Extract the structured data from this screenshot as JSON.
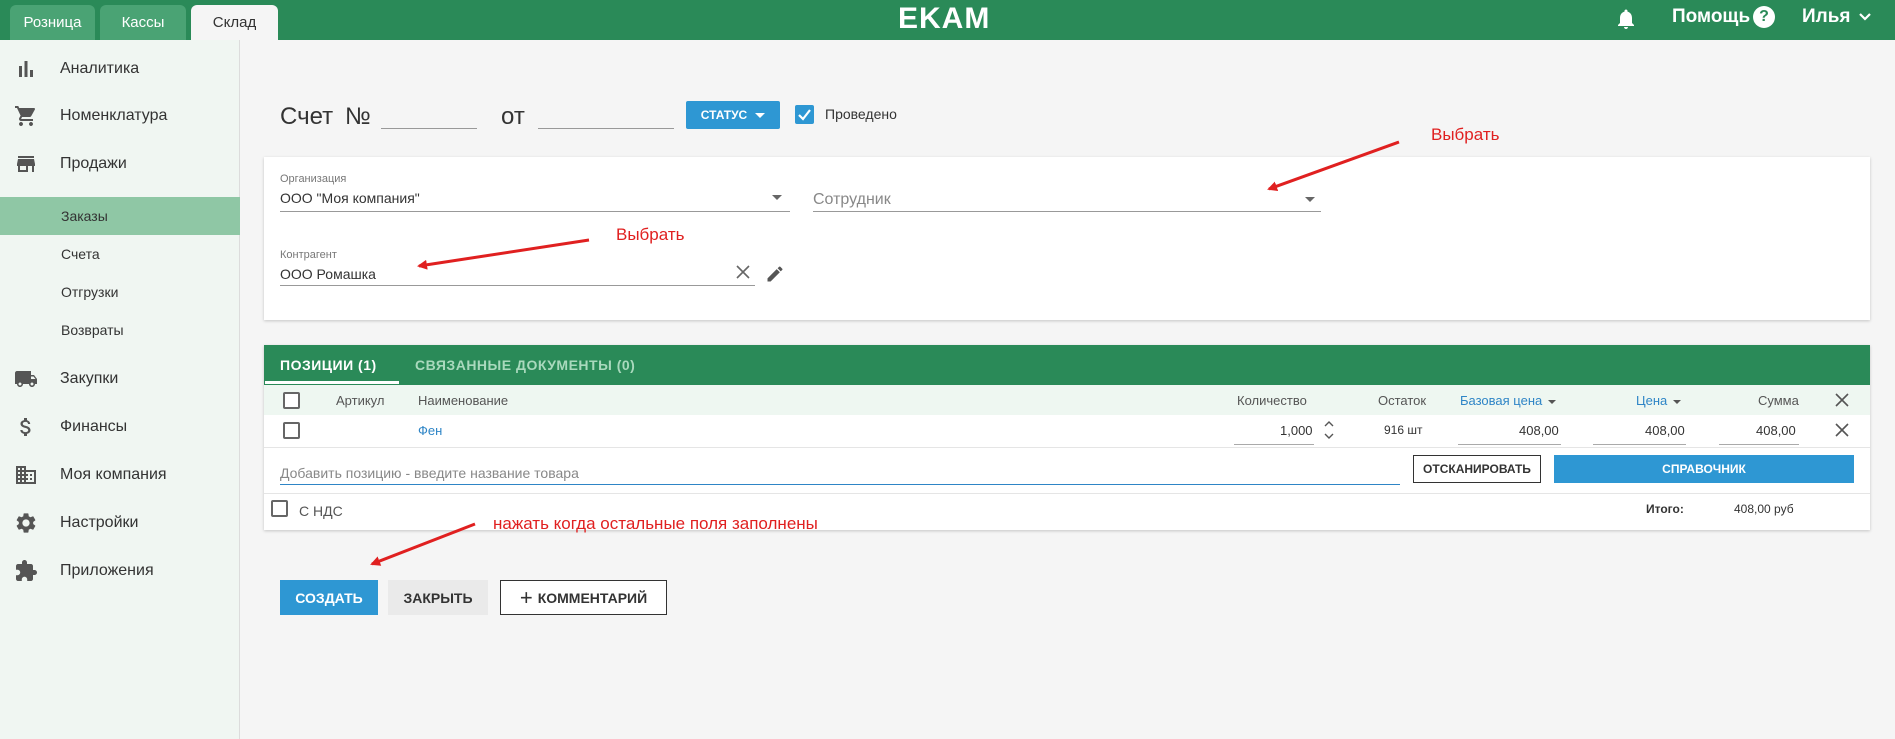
{
  "topbar": {
    "tabs": [
      {
        "label": "Розница"
      },
      {
        "label": "Кассы"
      },
      {
        "label": "Склад"
      }
    ],
    "logo": "EKAM",
    "help_label": "Помощь",
    "help_icon_text": "?",
    "user_name": "Илья",
    "accent_color": "#2a8a58"
  },
  "sidebar": {
    "items": [
      {
        "label": "Аналитика",
        "icon": "bar-chart-icon"
      },
      {
        "label": "Номенклатура",
        "icon": "cart-icon"
      },
      {
        "label": "Продажи",
        "icon": "store-icon"
      },
      {
        "label": "Закупки",
        "icon": "truck-icon"
      },
      {
        "label": "Финансы",
        "icon": "dollar-icon"
      },
      {
        "label": "Моя компания",
        "icon": "building-icon"
      },
      {
        "label": "Настройки",
        "icon": "gear-icon"
      },
      {
        "label": "Приложения",
        "icon": "puzzle-icon"
      }
    ],
    "sub_items": [
      {
        "label": "Заказы",
        "active": true
      },
      {
        "label": "Счета"
      },
      {
        "label": "Отгрузки"
      },
      {
        "label": "Возвраты"
      }
    ]
  },
  "header": {
    "title": "Счет",
    "number_sign": "№",
    "from_label": "от",
    "status_button": "СТАТУС",
    "posted_label": "Проведено",
    "posted_checked": true
  },
  "form": {
    "organization_label": "Организация",
    "organization_value": "ООО \"Моя компания\"",
    "employee_placeholder": "Сотрудник",
    "counterparty_label": "Контрагент",
    "counterparty_value": "ООО Ромашка"
  },
  "positions": {
    "tabs": [
      {
        "label": "ПОЗИЦИИ (1)"
      },
      {
        "label": "СВЯЗАННЫЕ ДОКУМЕНТЫ (0)"
      }
    ],
    "columns": {
      "article": "Артикул",
      "name": "Наименование",
      "qty": "Количество",
      "stock": "Остаток",
      "base_price": "Базовая цена",
      "price": "Цена",
      "sum": "Сумма"
    },
    "rows": [
      {
        "name": "Фен",
        "qty": "1,000",
        "stock": "916 шт",
        "base_price": "408,00",
        "price": "408,00",
        "sum": "408,00"
      }
    ],
    "add_placeholder": "Добавить позицию - введите название товара",
    "scan_button": "ОТСКАНИРОВАТЬ",
    "reference_button": "СПРАВОЧНИК",
    "vat_label": "С НДС",
    "total_label": "Итого:",
    "total_value": "408,00 руб"
  },
  "actions": {
    "create": "СОЗДАТЬ",
    "close": "ЗАКРЫТЬ",
    "comment": "КОММЕНТАРИЙ"
  },
  "annotations": {
    "select_employee": "Выбрать",
    "select_counterparty": "Выбрать",
    "press_create": "нажать когда остальные поля заполнены",
    "color": "#e02020"
  }
}
